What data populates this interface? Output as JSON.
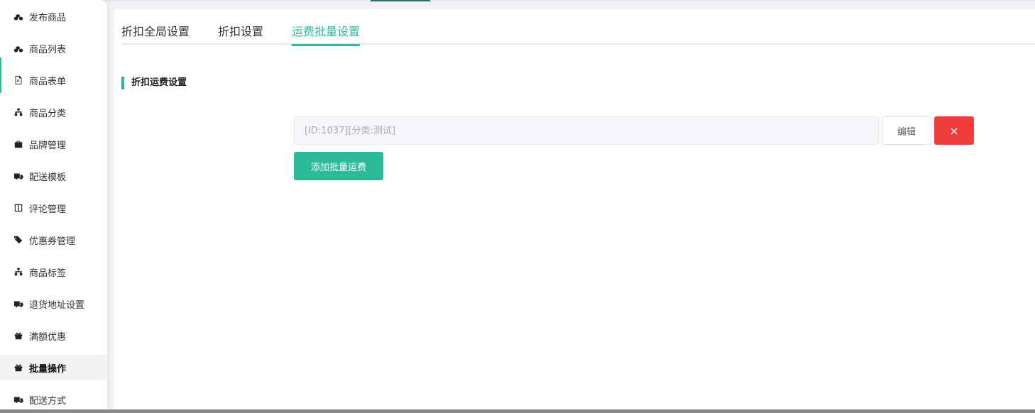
{
  "sidebar": {
    "items": [
      {
        "label": "发布商品",
        "icon": "cubes-icon"
      },
      {
        "label": "商品列表",
        "icon": "cubes-icon"
      },
      {
        "label": "商品表单",
        "icon": "excel-file-icon"
      },
      {
        "label": "商品分类",
        "icon": "sitemap-icon"
      },
      {
        "label": "品牌管理",
        "icon": "briefcase-icon"
      },
      {
        "label": "配送模板",
        "icon": "truck-icon"
      },
      {
        "label": "评论管理",
        "icon": "columns-icon"
      },
      {
        "label": "优惠券管理",
        "icon": "tags-icon"
      },
      {
        "label": "商品标签",
        "icon": "sitemap-icon"
      },
      {
        "label": "退货地址设置",
        "icon": "truck-icon"
      },
      {
        "label": "满额优惠",
        "icon": "gift-icon"
      },
      {
        "label": "批量操作",
        "icon": "gift-icon"
      },
      {
        "label": "配送方式",
        "icon": "truck-icon"
      }
    ],
    "active_index": 11
  },
  "tabs": [
    {
      "label": "折扣全局设置"
    },
    {
      "label": "折扣设置"
    },
    {
      "label": "运费批量设置"
    }
  ],
  "active_tab_index": 2,
  "section": {
    "title": "折扣运费设置"
  },
  "batch_shipping": {
    "input_placeholder": "[ID:1037][分类:测试]",
    "edit_label": "编辑",
    "delete_label": "×",
    "add_label": "添加批量运费"
  },
  "colors": {
    "accent": "#2bbb9a",
    "danger": "#f03c3c",
    "input_bg": "#f5f7fa"
  }
}
